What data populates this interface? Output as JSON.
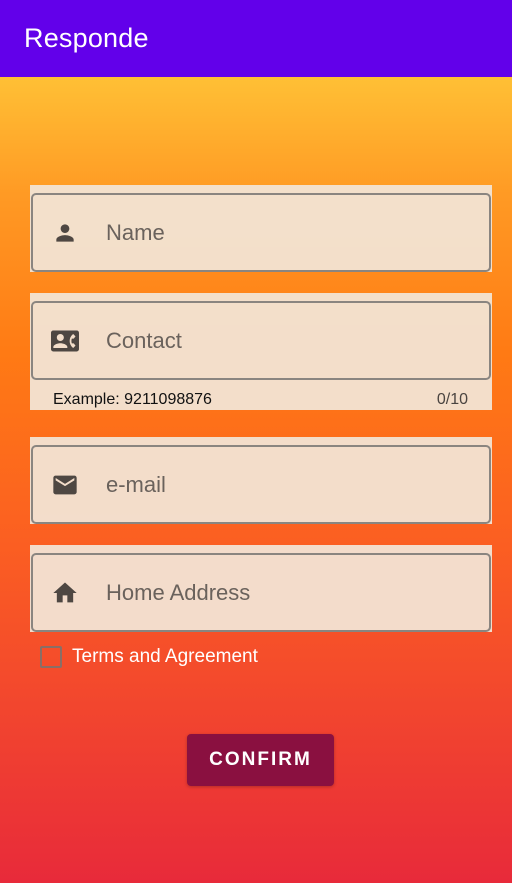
{
  "app_bar": {
    "title": "Responde",
    "color": "#6200ea"
  },
  "form": {
    "name_field": {
      "label": "Name",
      "icon": "person-icon"
    },
    "contact_field": {
      "label": "Contact",
      "icon": "contact-card-icon",
      "helper": "Example: 9211098876",
      "counter": "0/10"
    },
    "email_field": {
      "label": "e-mail",
      "icon": "mail-icon"
    },
    "address_field": {
      "label": "Home Address",
      "icon": "home-icon"
    },
    "terms": {
      "label": "Terms and Agreement",
      "checked": false
    },
    "confirm_button": {
      "label": "CONFIRM",
      "color": "#8a1040"
    }
  }
}
